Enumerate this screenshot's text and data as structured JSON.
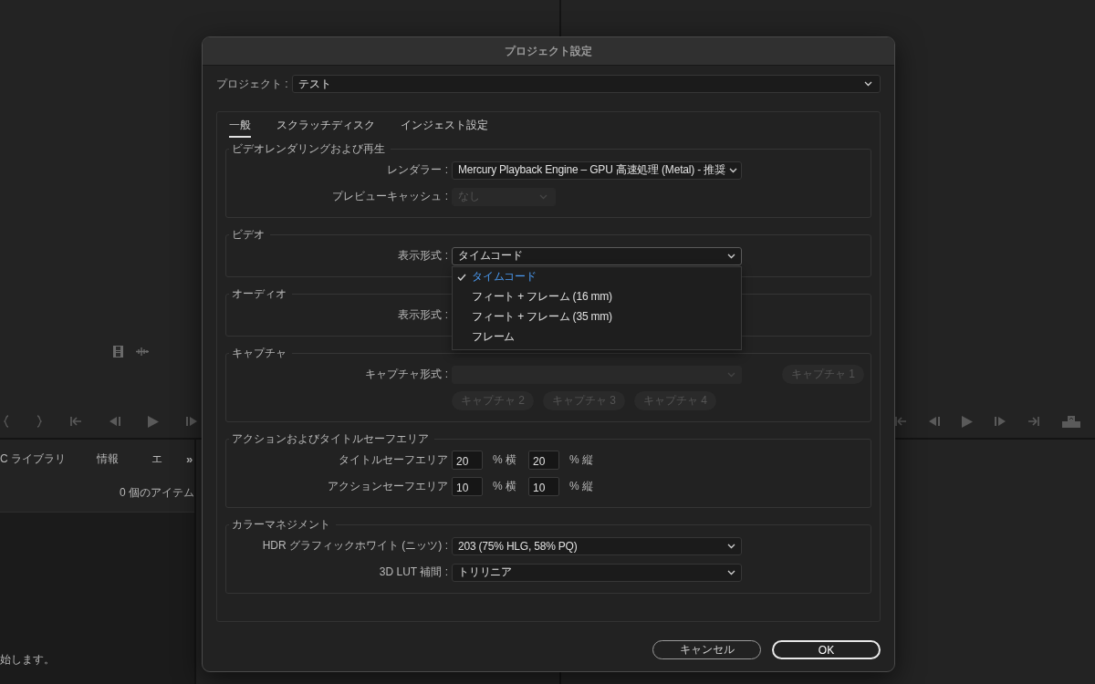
{
  "background": {
    "panel_tabs": [
      {
        "label": "C ライブラリ"
      },
      {
        "label": "情報"
      },
      {
        "label": "エ"
      }
    ],
    "more": "»",
    "item_count": "0 個のアイテム",
    "status_text": "始します。"
  },
  "dialog": {
    "title": "プロジェクト設定",
    "project": {
      "label": "プロジェクト :",
      "value": "テスト"
    },
    "tabs": [
      {
        "label": "一般",
        "selected": true
      },
      {
        "label": "スクラッチディスク",
        "selected": false
      },
      {
        "label": "インジェスト設定",
        "selected": false
      }
    ],
    "sections": [
      {
        "title": "ビデオレンダリングおよび再生",
        "rows": [
          {
            "kind": "select",
            "label": "レンダラー :",
            "value": "Mercury Playback Engine – GPU 高速処理 (Metal) - 推奨",
            "disabled": false
          },
          {
            "kind": "compact",
            "label": "プレビューキャッシュ :",
            "value": "なし",
            "disabled": true
          }
        ]
      },
      {
        "title": "ビデオ",
        "rows": [
          {
            "kind": "select",
            "label": "表示形式 :",
            "value": "タイムコード",
            "disabled": false,
            "expanded": true,
            "options": [
              {
                "label": "タイムコード",
                "selected": true
              },
              {
                "label": "フィート + フレーム (16 mm)",
                "selected": false
              },
              {
                "label": "フィート + フレーム (35 mm)",
                "selected": false
              },
              {
                "label": "フレーム",
                "selected": false
              }
            ]
          }
        ]
      },
      {
        "title": "オーディオ",
        "rows": [
          {
            "kind": "label",
            "label": "表示形式 :"
          }
        ]
      },
      {
        "title": "キャプチャ",
        "rows": [
          {
            "kind": "select",
            "label": "キャプチャ形式 :",
            "disabled": true,
            "button": {
              "label": "キャプチャ 1",
              "disabled": true
            }
          },
          {
            "kind": "buttons",
            "buttons": [
              {
                "label": "キャプチャ 2",
                "disabled": true
              },
              {
                "label": "キャプチャ 3",
                "disabled": true
              },
              {
                "label": "キャプチャ 4",
                "disabled": true
              }
            ]
          }
        ]
      },
      {
        "title": "アクションおよびタイトルセーフエリア",
        "rows": [
          {
            "kind": "safe",
            "label": "タイトルセーフエリア",
            "h": "20",
            "h_unit": "% 横",
            "v": "20",
            "v_unit": "% 縦"
          },
          {
            "kind": "safe",
            "label": "アクションセーフエリア",
            "h": "10",
            "h_unit": "% 横",
            "v": "10",
            "v_unit": "% 縦"
          }
        ]
      },
      {
        "title": "カラーマネジメント",
        "rows": [
          {
            "kind": "select",
            "label": "HDR グラフィックホワイト (ニッツ) :",
            "value": "203 (75% HLG, 58% PQ)",
            "disabled": false
          },
          {
            "kind": "select",
            "label": "3D LUT 補間 :",
            "value": "トリリニア",
            "disabled": false
          }
        ]
      }
    ],
    "buttons": [
      {
        "label": "キャンセル",
        "primary": false
      },
      {
        "label": "OK",
        "primary": true
      }
    ]
  }
}
